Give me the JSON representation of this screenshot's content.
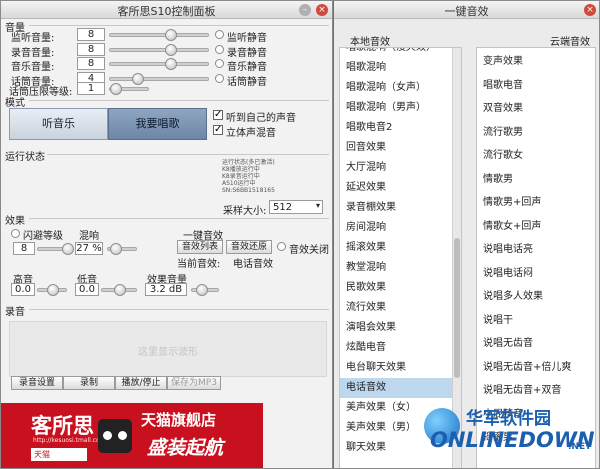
{
  "left_window": {
    "title": "客所思S10控制面板",
    "volume": {
      "section_label": "音量",
      "rows": [
        {
          "label": "监听音量:",
          "value": "8",
          "mute_label": "监听静音",
          "level": 0.62
        },
        {
          "label": "录音音量:",
          "value": "8",
          "mute_label": "录音静音",
          "level": 0.62
        },
        {
          "label": "音乐音量:",
          "value": "8",
          "mute_label": "音乐静音",
          "level": 0.62
        },
        {
          "label": "话筒音量:",
          "value": "4",
          "mute_label": "话筒静音",
          "level": 0.25
        }
      ],
      "compress_label": "话筒压限等级:",
      "compress_value": "1",
      "compress_level": 0.0
    },
    "mode": {
      "section_label": "模式",
      "listen_button": "听音乐",
      "sing_button": "我要唱歌",
      "hear_self_label": "听到自己的声音",
      "stereo_mix_label": "立体声混音",
      "hear_self_checked": true,
      "stereo_mix_checked": true
    },
    "status": {
      "section_label": "运行状态",
      "info_lines": [
        "运行状态(多已激活)",
        "K8播放运行中",
        "K8录音运行中",
        "AS10运行中",
        "SN:S6BB1518165"
      ],
      "sample_label": "采样大小:",
      "sample_value": "512"
    },
    "effects": {
      "section_label": "效果",
      "echo_label": "闪避等级",
      "echo_value": "8",
      "reverb_label": "混响",
      "reverb_value": "27 %",
      "one_key_label": "一键音效",
      "list_button": "音效列表",
      "restore_button": "音效还原",
      "effect_off_label": "音效关闭",
      "current_label": "当前音效:",
      "current_value": "电话音效",
      "treble_label": "高音",
      "treble_value": "0.0",
      "bass_label": "低音",
      "bass_value": "0.0",
      "effect_vol_label": "效果音量",
      "effect_vol_value": "3.2 dB"
    },
    "record": {
      "section_label": "录音",
      "waveform_placeholder": "这里显示波形",
      "buttons": [
        "录音设置",
        "录制",
        "播放/停止",
        "保存为MP3"
      ]
    },
    "banner": {
      "brand": "客所思",
      "url": "http://kesuosi.tmall.com",
      "tmall_tag": "天猫",
      "store": "天猫旗舰店",
      "slogan": "盛装起航",
      "bg_color": "#c8101e"
    }
  },
  "right_window": {
    "title": "一键音效",
    "local_tab": "本地音效",
    "cloud_tab": "云端音效",
    "local_list": [
      "唱歌混响（漫天效）",
      "唱歌混响",
      "唱歌混响（女声）",
      "唱歌混响（男声）",
      "唱歌电音2",
      "回音效果",
      "大厅混响",
      "延迟效果",
      "录音棚效果",
      "房间混响",
      "摇滚效果",
      "教堂混响",
      "民歌效果",
      "流行效果",
      "演唱会效果",
      "炫酷电音",
      "电台聊天效果",
      "电话音效",
      "美声效果（女）",
      "美声效果（男）",
      "聊天效果"
    ],
    "local_selected": "电话音效",
    "cloud_list": [
      "变声效果",
      "唱歌电音",
      "双音效果",
      "流行歌男",
      "流行歌女",
      "情歌男",
      "情歌男+回声",
      "情歌女+回声",
      "说唱电话亮",
      "说唱电话闷",
      "说唱多人效果",
      "说唱干",
      "说唱无齿音",
      "说唱无齿音+倍儿爽",
      "说唱无齿音+双音",
      "小屁孩音",
      "摇滚男"
    ]
  },
  "watermark": {
    "cn": "华军软件园",
    "en": "ONLINEDOWN",
    "suffix": ".NET"
  }
}
